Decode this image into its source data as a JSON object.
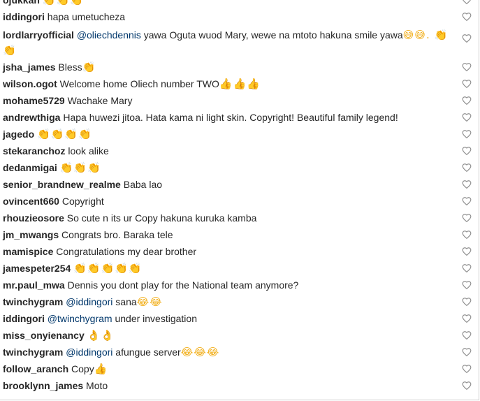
{
  "comments": [
    {
      "user": "ojukkah",
      "mention": "",
      "text": "",
      "emoji": "👏👏👏",
      "tall": false
    },
    {
      "user": "iddingori",
      "mention": "",
      "text": "hapa umetucheza",
      "emoji": "",
      "tall": false
    },
    {
      "user": "lordlarryofficial",
      "mention": "@oliechdennis",
      "text": "yawa Oguta wuod Mary, wewe na mtoto hakuna smile yawa",
      "emoji": "😅😅. 👏👏",
      "tall": true
    },
    {
      "user": "jsha_james",
      "mention": "",
      "text": "Bless",
      "emoji": "👏",
      "tall": false
    },
    {
      "user": "wilson.ogot",
      "mention": "",
      "text": "Welcome home Oliech number TWO",
      "emoji": "👍👍👍",
      "tall": false
    },
    {
      "user": "mohame5729",
      "mention": "",
      "text": "Wachake Mary",
      "emoji": "",
      "tall": false
    },
    {
      "user": "andrewthiga",
      "mention": "",
      "text": "Hapa huwezi jitoa. Hata kama ni light skin. Copyright! Beautiful family legend!",
      "emoji": "",
      "tall": false
    },
    {
      "user": "jagedo",
      "mention": "",
      "text": "",
      "emoji": "👏👏👏👏",
      "tall": false
    },
    {
      "user": "stekaranchoz",
      "mention": "",
      "text": "look alike",
      "emoji": "",
      "tall": false
    },
    {
      "user": "dedanmigai",
      "mention": "",
      "text": "",
      "emoji": "👏👏👏",
      "tall": false
    },
    {
      "user": "senior_brandnew_realme",
      "mention": "",
      "text": "Baba lao",
      "emoji": "",
      "tall": false
    },
    {
      "user": "ovincent660",
      "mention": "",
      "text": "Copyright",
      "emoji": "",
      "tall": false
    },
    {
      "user": "rhouzieosore",
      "mention": "",
      "text": "So cute n its ur Copy hakuna kuruka kamba",
      "emoji": "",
      "tall": false
    },
    {
      "user": "jm_mwangs",
      "mention": "",
      "text": "Congrats bro. Baraka tele",
      "emoji": "",
      "tall": false
    },
    {
      "user": "mamispice",
      "mention": "",
      "text": "Congratulations my dear brother",
      "emoji": "",
      "tall": false
    },
    {
      "user": "jamespeter254",
      "mention": "",
      "text": "",
      "emoji": "👏👏👏👏👏",
      "tall": false
    },
    {
      "user": "mr.paul_mwa",
      "mention": "",
      "text": "Dennis you dont play for the National team anymore?",
      "emoji": "",
      "tall": false
    },
    {
      "user": "twinchygram",
      "mention": "@iddingori",
      "text": "sana",
      "emoji": "😂😂",
      "tall": false
    },
    {
      "user": "iddingori",
      "mention": "@twinchygram",
      "text": "under investigation",
      "emoji": "",
      "tall": false
    },
    {
      "user": "miss_onyienancy",
      "mention": "",
      "text": "",
      "emoji": "👌👌",
      "tall": false
    },
    {
      "user": "twinchygram",
      "mention": "@iddingori",
      "text": "afungue server",
      "emoji": "😂😂😂",
      "tall": false
    },
    {
      "user": "follow_aranch",
      "mention": "",
      "text": "Copy",
      "emoji": "👍",
      "tall": false
    },
    {
      "user": "brooklynn_james",
      "mention": "",
      "text": "Moto",
      "emoji": "",
      "tall": false
    }
  ],
  "icons": {
    "like": "heart-outline-icon"
  },
  "colors": {
    "username": "#262626",
    "mention": "#00376b",
    "heart": "#8e8e8e",
    "emoji": "#f2b01e"
  }
}
